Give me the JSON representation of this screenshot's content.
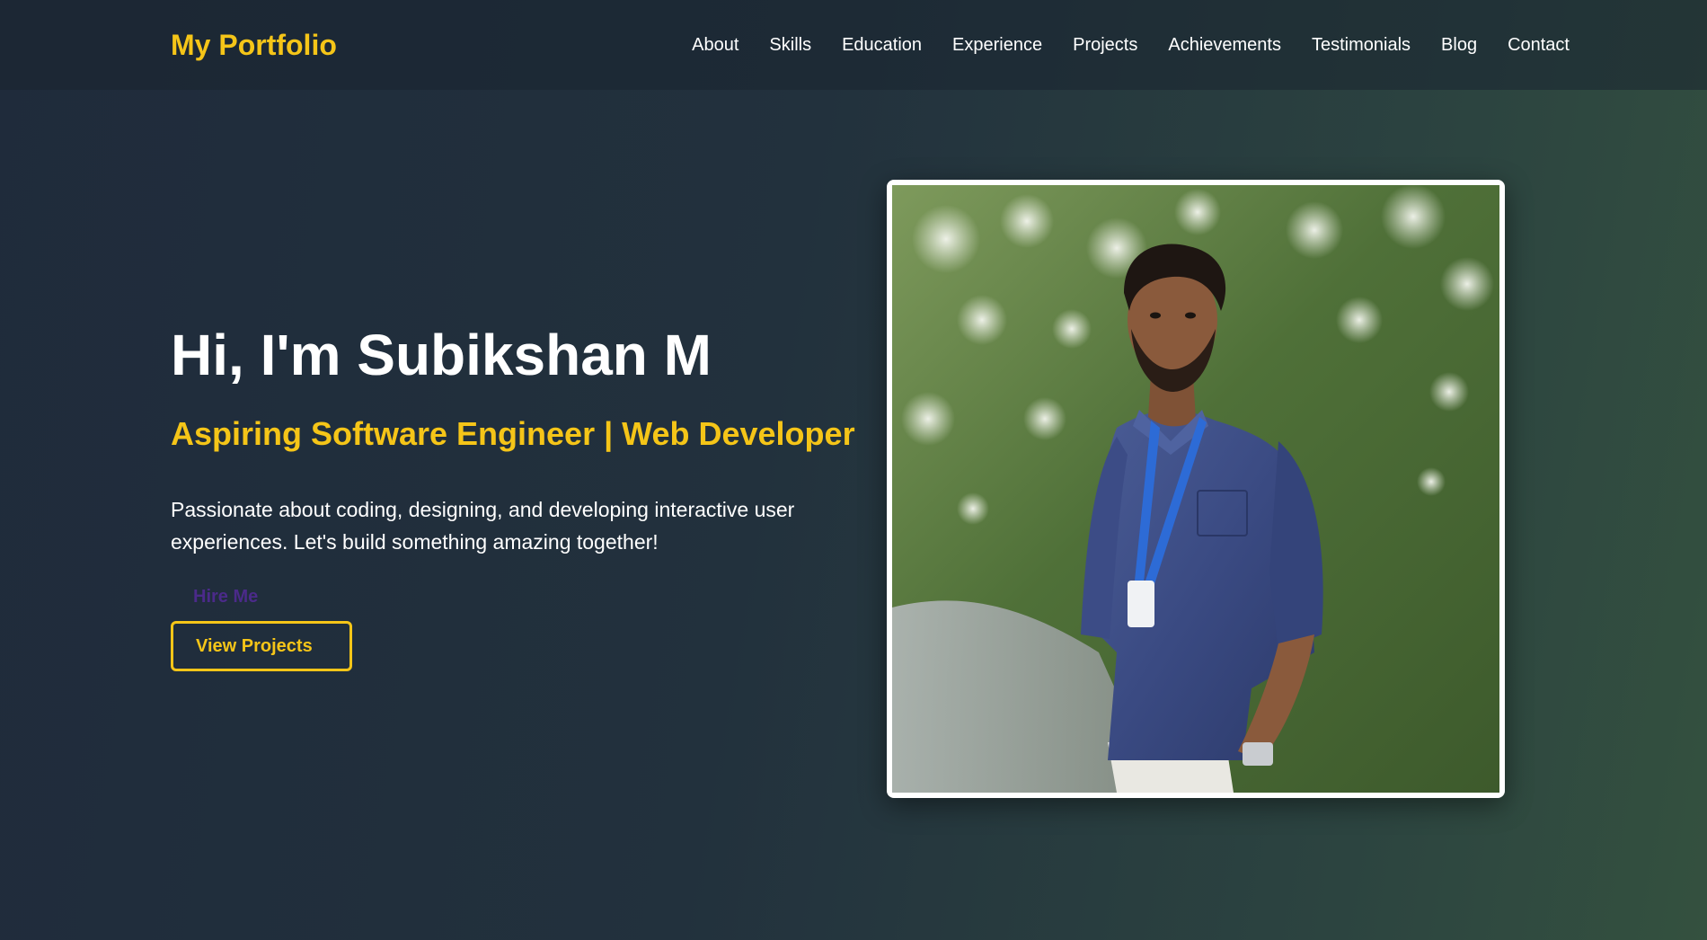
{
  "nav": {
    "logo": "My Portfolio",
    "links": [
      "About",
      "Skills",
      "Education",
      "Experience",
      "Projects",
      "Achievements",
      "Testimonials",
      "Blog",
      "Contact"
    ]
  },
  "hero": {
    "title": "Hi, I'm Subikshan M",
    "subtitle": "Aspiring Software Engineer | Web Developer",
    "description": "Passionate about coding, designing, and developing interactive user experiences. Let's build something amazing together!",
    "hire_label": "Hire Me",
    "projects_label": "View Projects"
  },
  "colors": {
    "accent": "#f5c518",
    "text": "#ffffff",
    "hire_text": "#4b2a8a",
    "bg_start": "#1f2b3b",
    "bg_end": "#34513f"
  },
  "icons": {
    "profile_photo": "person-photo"
  }
}
